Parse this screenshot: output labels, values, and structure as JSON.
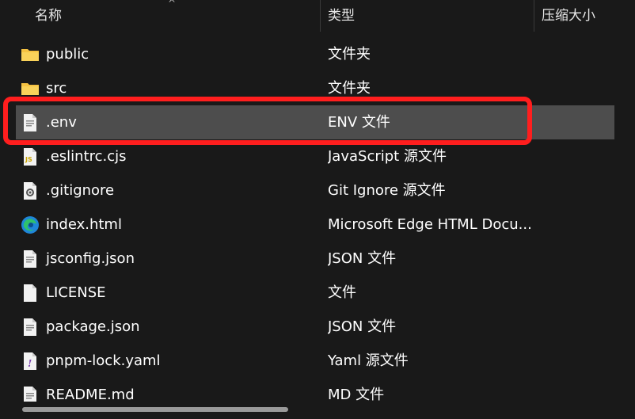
{
  "header": {
    "col_name": "名称",
    "col_type": "类型",
    "col_size": "压缩大小",
    "sort_glyph": "^"
  },
  "files": [
    {
      "name": "public",
      "type": "文件夹",
      "icon": "folder-icon"
    },
    {
      "name": "src",
      "type": "文件夹",
      "icon": "folder-icon"
    },
    {
      "name": ".env",
      "type": "ENV 文件",
      "icon": "text-file-icon",
      "selected": true
    },
    {
      "name": ".eslintrc.cjs",
      "type": "JavaScript 源文件",
      "icon": "js-file-icon"
    },
    {
      "name": ".gitignore",
      "type": "Git Ignore 源文件",
      "icon": "gear-file-icon"
    },
    {
      "name": "index.html",
      "type": "Microsoft Edge HTML Docu...",
      "icon": "edge-icon"
    },
    {
      "name": "jsconfig.json",
      "type": "JSON 文件",
      "icon": "text-file-icon"
    },
    {
      "name": "LICENSE",
      "type": "文件",
      "icon": "blank-file-icon"
    },
    {
      "name": "package.json",
      "type": "JSON 文件",
      "icon": "text-file-icon"
    },
    {
      "name": "pnpm-lock.yaml",
      "type": "Yaml 源文件",
      "icon": "yaml-file-icon"
    },
    {
      "name": "README.md",
      "type": "MD 文件",
      "icon": "text-file-icon"
    }
  ],
  "colors": {
    "background": "#191919",
    "selected_row": "#4d4d4d",
    "highlight_border": "#ff1e1e",
    "folder": "#f5c242"
  }
}
